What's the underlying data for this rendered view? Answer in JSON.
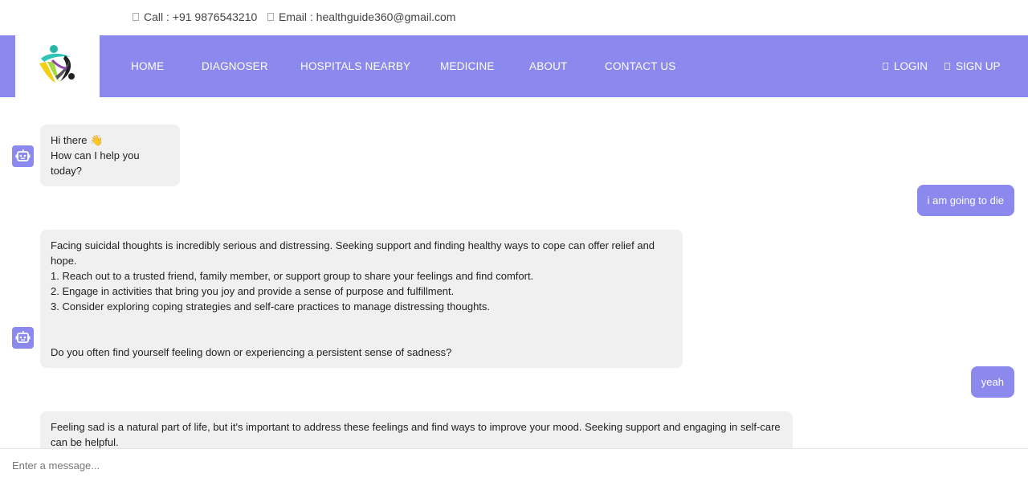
{
  "topbar": {
    "call": "Call : +91 9876543210",
    "email": "Email : healthguide360@gmail.com"
  },
  "nav": {
    "home": "HOME",
    "diagnoser": "DIAGNOSER",
    "hospitals": "HOSPITALS NEARBY",
    "medicine": "MEDICINE",
    "about": "ABOUT",
    "contact": "CONTACT US",
    "login": "LOGIN",
    "signup": "SIGN UP"
  },
  "colors": {
    "accent": "#8b89ee",
    "bot_bubble": "#f0f0f0"
  },
  "icons": {
    "logo": "healthguide-logo",
    "bot": "robot-icon"
  },
  "messages": {
    "bot1": {
      "line1": "Hi there 👋",
      "line2": "How can I help you today?"
    },
    "user1": "i am going to die",
    "bot2": {
      "line1": "Facing suicidal thoughts is incredibly serious and distressing. Seeking support and finding healthy ways to cope can offer relief and hope.",
      "line2": "1. Reach out to a trusted friend, family member, or support group to share your feelings and find comfort.",
      "line3": "2. Engage in activities that bring you joy and provide a sense of purpose and fulfillment.",
      "line4": "3. Consider exploring coping strategies and self-care practices to manage distressing thoughts.",
      "line5": "Do you often find yourself feeling down or experiencing a persistent sense of sadness?"
    },
    "user2": "yeah",
    "bot3": {
      "line1": "Feeling sad is a natural part of life, but it's important to address these feelings and find ways to improve your mood. Seeking support and engaging in self-care can be helpful."
    }
  },
  "input": {
    "placeholder": "Enter a message..."
  }
}
